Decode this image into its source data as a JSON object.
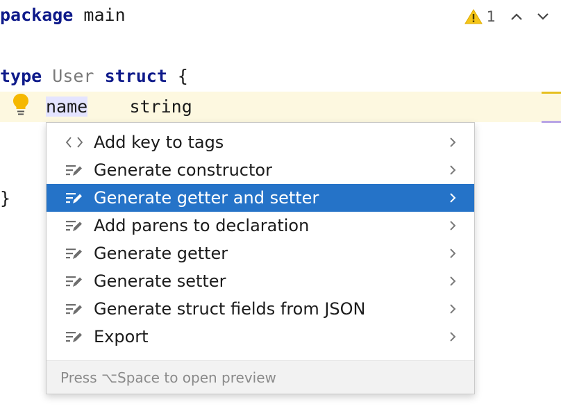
{
  "editor": {
    "line1": {
      "kw": "package",
      "rest": " main"
    },
    "line3": {
      "kw1": "type",
      "type_name": "User",
      "kw2": "struct",
      "rest": " {"
    },
    "line4": {
      "field": "name",
      "spacing": "    ",
      "type": "string"
    },
    "line6": {
      "text": "}"
    }
  },
  "inspections": {
    "count": "1",
    "icon": "warning-icon",
    "prev_icon": "chevron-up-icon",
    "next_icon": "chevron-down-icon"
  },
  "popup": {
    "items": [
      {
        "label": "Add key to tags",
        "icon": "angle-brackets-icon",
        "selected": false
      },
      {
        "label": "Generate constructor",
        "icon": "edit-lines-icon",
        "selected": false
      },
      {
        "label": "Generate getter and setter",
        "icon": "edit-lines-icon",
        "selected": true
      },
      {
        "label": "Add parens to declaration",
        "icon": "edit-lines-icon",
        "selected": false
      },
      {
        "label": "Generate getter",
        "icon": "edit-lines-icon",
        "selected": false
      },
      {
        "label": "Generate setter",
        "icon": "edit-lines-icon",
        "selected": false
      },
      {
        "label": "Generate struct fields from JSON",
        "icon": "edit-lines-icon",
        "selected": false
      },
      {
        "label": "Export",
        "icon": "edit-lines-icon",
        "selected": false
      }
    ],
    "footer": "Press ⌥Space to open preview"
  },
  "colors": {
    "keyword": "#0e1a8a",
    "selection": "#2573c8",
    "warning": "#f5c518",
    "current_line": "#fdf8e0"
  }
}
